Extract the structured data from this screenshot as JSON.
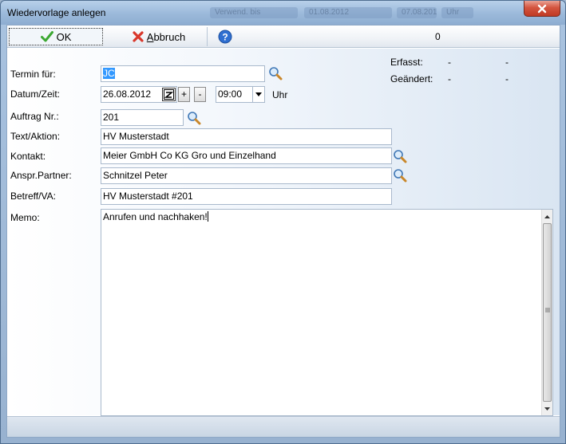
{
  "window": {
    "title": "Wiedervorlage anlegen",
    "background_left": [
      "Verwend. bis",
      "01.08.2012",
      "07.08.2012",
      "Uhr"
    ]
  },
  "toolbar": {
    "ok_label": "OK",
    "cancel_label": "Abbruch",
    "cancel_accesskey": "A",
    "cancel_rest": "bbruch",
    "count": "0"
  },
  "form": {
    "termin_label": "Termin für:",
    "termin_value": "JC",
    "datum_label": "Datum/Zeit:",
    "datum_value": "26.08.2012",
    "plus_label": "+",
    "minus_label": "-",
    "time_value": "09:00",
    "uhr_label": "Uhr",
    "auftrag_label": "Auftrag Nr.:",
    "auftrag_value": "201",
    "text_label": "Text/Aktion:",
    "text_value": "HV Musterstadt",
    "kontakt_label": "Kontakt:",
    "kontakt_value": "Meier GmbH  Co KG Gro und Einzelhand",
    "anspr_label": "Anspr.Partner:",
    "anspr_value": "Schnitzel Peter",
    "betreff_label": "Betreff/VA:",
    "betreff_value": "HV Musterstadt #201",
    "memo_label": "Memo:",
    "memo_value": "Anrufen und nachhaken!",
    "erfasst_label": "Erfasst:",
    "erfasst_value1": "-",
    "erfasst_value2": "-",
    "geaendert_label": "Geändert:",
    "geaendert_value1": "-",
    "geaendert_value2": "-"
  },
  "icons": {
    "ok": "check-icon",
    "cancel": "red-x-icon",
    "help": "help-icon",
    "lookup": "magnifier-icon",
    "calendar": "calendar-icon",
    "close": "close-icon"
  },
  "colors": {
    "ok_check": "#3ca832",
    "cancel_x": "#d9372b",
    "help_blue": "#2f6fd1",
    "selection": "#3399ff",
    "close_red": "#c8412b"
  }
}
